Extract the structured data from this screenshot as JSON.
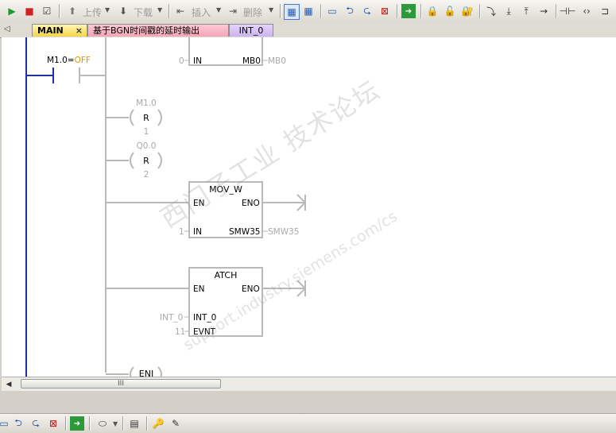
{
  "toolbar": {
    "upload_label": "上传",
    "download_label": "下载",
    "insert_label": "插入",
    "delete_label": "删除"
  },
  "tabs": [
    {
      "label": "MAIN",
      "active": true,
      "close": "×"
    },
    {
      "label": "基于BGN时间戳的延时输出"
    },
    {
      "label": "INT_0"
    }
  ],
  "ladder": {
    "contact_label": "M1.0=",
    "contact_state": "OFF",
    "mov_b_in_value": "0",
    "mov_b_in_pin": "IN",
    "mov_b_out_pin": "MB0",
    "mov_b_out_value": "MB0",
    "reset1": {
      "address": "M1.0",
      "letter": "R",
      "count": "1"
    },
    "reset2": {
      "address": "Q0.0",
      "letter": "R",
      "count": "2"
    },
    "mov_w": {
      "title": "MOV_W",
      "en": "EN",
      "eno": "ENO",
      "in_value": "1",
      "in_pin": "IN",
      "out_pin": "SMW35",
      "out_value": "SMW35"
    },
    "atch": {
      "title": "ATCH",
      "en": "EN",
      "eno": "ENO",
      "int_value": "INT_0",
      "int_pin": "INT_0",
      "evnt_value": "11",
      "evnt_pin": "EVNT"
    },
    "eni": "ENI"
  },
  "watermark": {
    "main": "西门子工业  技术论坛",
    "url": "support.industry.siemens.com/cs"
  },
  "scrollbar": {
    "grip": "III"
  }
}
